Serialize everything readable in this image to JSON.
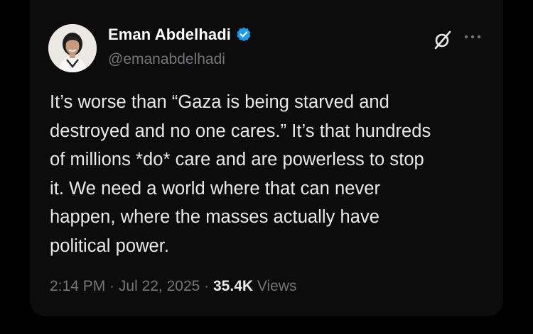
{
  "author": {
    "name": "Eman Abdelhadi",
    "handle": "@emanabdelhadi",
    "verified": true,
    "verified_color": "#1d9bf0"
  },
  "tweet": {
    "lines": [
      "It’s worse than “Gaza is being starved and",
      "destroyed and no one cares.” It’s that hundreds",
      "of millions *do* care and are powerless to stop",
      "it. We need a world where that can never",
      "happen, where the masses actually have",
      "political power."
    ]
  },
  "meta": {
    "time": "2:14 PM",
    "separator1": " · ",
    "date": "Jul 22, 2025",
    "separator2": " · ",
    "views_count": "35.4K",
    "views_label": " Views"
  },
  "icons": {
    "grok": "grok-icon",
    "more": "more-icon",
    "verified": "verified-badge-icon"
  },
  "colors": {
    "background": "#000000",
    "card": "#0c0c0c",
    "text": "#e7e9ea",
    "muted": "#71767b"
  }
}
